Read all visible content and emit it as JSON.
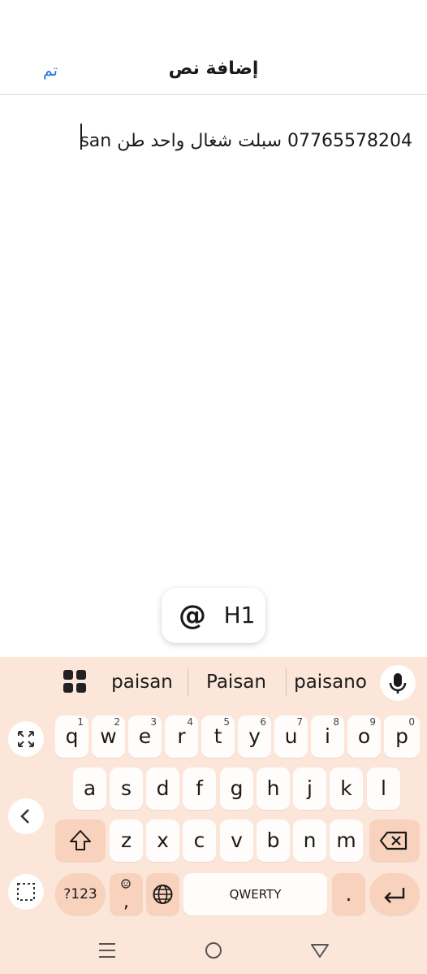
{
  "header": {
    "title": "إضافة نص",
    "done_label": "تم"
  },
  "editor": {
    "text": "07765578204 سبلت شغال واحد طن paisan"
  },
  "chip": {
    "at_label": "@",
    "heading_label": "H1"
  },
  "keyboard": {
    "suggestions": [
      "paisan",
      "Paisan",
      "paisano"
    ],
    "row1": [
      {
        "label": "q",
        "hint": "1"
      },
      {
        "label": "w",
        "hint": "2"
      },
      {
        "label": "e",
        "hint": "3"
      },
      {
        "label": "r",
        "hint": "4"
      },
      {
        "label": "t",
        "hint": "5"
      },
      {
        "label": "y",
        "hint": "6"
      },
      {
        "label": "u",
        "hint": "7"
      },
      {
        "label": "i",
        "hint": "8"
      },
      {
        "label": "o",
        "hint": "9"
      },
      {
        "label": "p",
        "hint": "0"
      }
    ],
    "row2": [
      "a",
      "s",
      "d",
      "f",
      "g",
      "h",
      "j",
      "k",
      "l"
    ],
    "row3": [
      "z",
      "x",
      "c",
      "v",
      "b",
      "n",
      "m"
    ],
    "symbols_label": "?123",
    "comma_label": ",",
    "space_label": "QWERTY",
    "period_label": ".",
    "accent_color": "#f8d2bc",
    "background_color": "#fbe6d9"
  },
  "icons": {
    "grid": "apps-grid-icon",
    "mic": "microphone-icon",
    "expand": "expand-icon",
    "back": "chevron-left-icon",
    "select": "selection-icon",
    "shift": "shift-icon",
    "backspace": "backspace-icon",
    "emoji": "emoji-icon",
    "globe": "globe-icon",
    "enter": "enter-icon",
    "nav_recents": "menu-icon",
    "nav_home": "home-icon",
    "nav_back": "back-triangle-icon"
  },
  "colors": {
    "done_blue": "#1a73e8"
  }
}
